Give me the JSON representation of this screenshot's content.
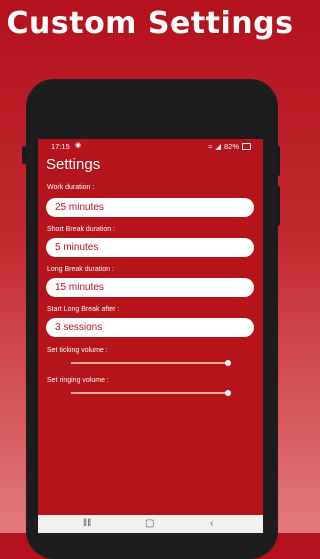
{
  "promo": {
    "title": "Custom Settings"
  },
  "status_bar": {
    "time": "17:15",
    "battery": "82%"
  },
  "screen": {
    "title": "Settings",
    "fields": [
      {
        "label": "Work duration :",
        "value": "25 minutes"
      },
      {
        "label": "Short Break duration :",
        "value": "5 minutes"
      },
      {
        "label": "Long Break duration :",
        "value": "15 minutes"
      },
      {
        "label": "Start Long Break after :",
        "value": "3 sessions"
      }
    ],
    "sliders": [
      {
        "label": "Set ticking volume :",
        "value": 0.99
      },
      {
        "label": "Set ringing volume :",
        "value": 0.99
      }
    ]
  },
  "nav": {
    "recents_icon": "recents-icon",
    "home_icon": "home-icon",
    "back_icon": "back-icon"
  },
  "colors": {
    "accent": "#b5141a",
    "background": "#c22a2f"
  }
}
